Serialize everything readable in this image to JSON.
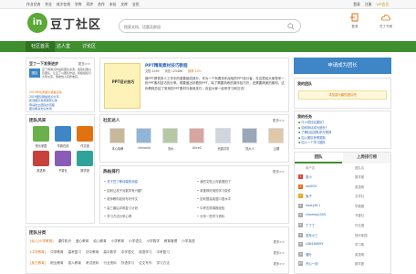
{
  "topnav": {
    "links": [
      "作业交流",
      "作业",
      "成才在线",
      "学库",
      "同步",
      "合作",
      "本站",
      "文库",
      "全优"
    ],
    "right": [
      "登录",
      "注册"
    ],
    "vip": "VIP会员"
  },
  "header": {
    "logo_glyph": "in",
    "site_name": "豆丁社区",
    "search_placeholder": "搜索文档、话题及群组",
    "login_label": "登录",
    "cloud_label": "豆丁书房"
  },
  "mainnav": {
    "items": [
      "社区首页",
      "达人堂",
      "讨论区"
    ]
  },
  "intro": {
    "title": "豆丁一下发表进步",
    "more": "更多>>",
    "logo": "团队",
    "text": "豆丁网通过作品和团队资源，组建社团以及团队，让豆丁以团队作战，积极组织与大家交流，帮助他人有所收获。",
    "links": [
      "2019年优秀团队讲堂活动",
      "2019团队网络知识分享",
      "新闻团队考核规则公告",
      "申请建立团队的流程",
      "团队相关知识支持"
    ]
  },
  "group": {
    "title": "团队风采",
    "tiles": [
      {
        "label": "快乐家园",
        "color": "#6bb04a"
      },
      {
        "label": "学霸在线",
        "color": "#3e86c5"
      },
      {
        "label": "作文团",
        "color": "#e2720f"
      },
      {
        "label": "英语角",
        "color": "#c8413a"
      },
      {
        "label": "书香社",
        "color": "#8a5cb8"
      },
      {
        "label": "数学团",
        "color": "#2fa39a"
      }
    ]
  },
  "feature": {
    "image_text": "PPT设计技巧",
    "title": "PPT精美素材技巧教程",
    "stats": [
      "文档 2269",
      "浏览 125486",
      "推荐 53%"
    ],
    "text": "做PPT是很多人工作中的重要组成部分，作为一个有着多年经验的PPT设计者，在这里给大家带来一份PPT素材技巧的分享。想要做出好看的PPT，除了需要熟练的操作技巧外，还需要精美的素材。这份教程总结了常用的PPT素材与使用技巧，欢迎大家一起来学习和交流！"
  },
  "members": {
    "title": "社区达人",
    "more": "更多>>",
    "people": [
      {
        "name": "本心晓萌",
        "color": "#c8b89a"
      },
      {
        "name": "chinaxia",
        "color": "#8fb6d8"
      },
      {
        "name": "流水",
        "color": "#b7c7a4"
      },
      {
        "name": "AliceC",
        "color": "#d6a7a0"
      },
      {
        "name": "资源共享",
        "color": "#cfd6de"
      },
      {
        "name": "陆大人",
        "color": "#9aa7b8"
      },
      {
        "name": "云烟",
        "color": "#e0c8a8"
      }
    ]
  },
  "hot": {
    "title": "热帖排行",
    "more": "更多>>",
    "left": [
      "关于豆丁移动端的消息",
      "如何让孩子对数学有兴趣？",
      "老师教你如何写好作文",
      "高三最后冲刺复习计划",
      "学习方法分享心得"
    ],
    "right": [
      "我的文档上传被退回了",
      "求推荐好用的学习软件",
      "如何提高英语口语水平",
      "中考志愿填报经验",
      "分享一些学习资料"
    ]
  },
  "apply": {
    "label": "申请成为团长"
  },
  "mygroups": {
    "title": "我的团队",
    "hint": "寻找感兴趣的团队吧"
  },
  "tasks": {
    "title": "我的任务",
    "items": [
      "什么是社区团队？",
      "如何申请成为团长？",
      "了解社区团队积分规则",
      "加入团队获得奖励",
      "加入一个学习团队"
    ]
  },
  "rank": {
    "tabs": [
      "团队",
      "上周排行榜"
    ],
    "headers": [
      "用户名",
      "团队名"
    ],
    "rows": [
      {
        "num": "1",
        "name": "夏小",
        "group": "数学团"
      },
      {
        "name": "sail010",
        "num": "2",
        "group": "英语角"
      },
      {
        "num": "3",
        "name": "兔子",
        "group": "文学社"
      },
      {
        "num": "4",
        "name": "hooty811",
        "group": "学霸团"
      },
      {
        "num": "5",
        "name": "cheeleg2345",
        "group": "书香社"
      },
      {
        "num": "6",
        "name": "丁丁丁",
        "group": "作文团"
      },
      {
        "num": "7",
        "name": "发布小三",
        "group": "快乐家园"
      },
      {
        "num": "8",
        "name": "s38436893",
        "group": "学习角"
      },
      {
        "num": "9",
        "name": "落叶",
        "group": "英语角"
      },
      {
        "num": "10",
        "name": "开心一刻",
        "group": "数学团"
      }
    ]
  },
  "cats": {
    "title": "团队分类",
    "rows": [
      {
        "label": "[幼儿/小学教育]",
        "items": [
          "课件知识",
          "爱心教育",
          "幼儿教育",
          "小学教育",
          "小学语文",
          "小学数学",
          "教育管理",
          "小学英语"
        ]
      },
      {
        "label": "[中学教育]",
        "items": [
          "中学教育",
          "高考复习",
          "初中教育",
          "高中数学",
          "中学语文",
          "英语学习",
          "中考复习"
        ]
      },
      {
        "label": "[其它教育]",
        "items": [
          "职业教育",
          "成人教育",
          "考试资料",
          "行业资料",
          "外语学习",
          "论文写作",
          "学习方法"
        ]
      }
    ],
    "more": "更多>>"
  }
}
